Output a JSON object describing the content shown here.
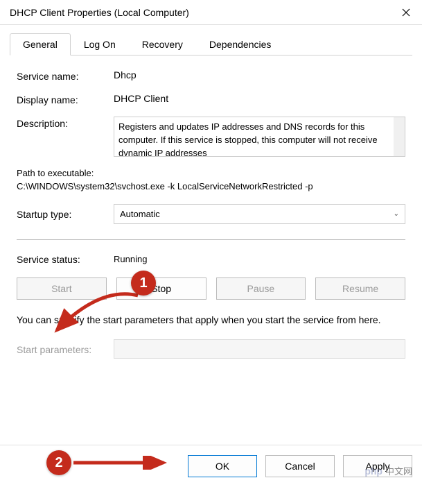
{
  "titlebar": {
    "title": "DHCP Client Properties (Local Computer)"
  },
  "tabs": {
    "general": "General",
    "logon": "Log On",
    "recovery": "Recovery",
    "dependencies": "Dependencies"
  },
  "general": {
    "service_name_label": "Service name:",
    "service_name_value": "Dhcp",
    "display_name_label": "Display name:",
    "display_name_value": "DHCP Client",
    "description_label": "Description:",
    "description_value": "Registers and updates IP addresses and DNS records for this computer. If this service is stopped, this computer will not receive dynamic IP addresses",
    "path_label": "Path to executable:",
    "path_value": "C:\\WINDOWS\\system32\\svchost.exe -k LocalServiceNetworkRestricted -p",
    "startup_type_label": "Startup type:",
    "startup_type_value": "Automatic",
    "status_label": "Service status:",
    "status_value": "Running",
    "buttons": {
      "start": "Start",
      "stop": "Stop",
      "pause": "Pause",
      "resume": "Resume"
    },
    "help_text": "You can specify the start parameters that apply when you start the service from here.",
    "start_params_label": "Start parameters:",
    "start_params_value": ""
  },
  "footer": {
    "ok": "OK",
    "cancel": "Cancel",
    "apply": "Apply"
  },
  "annotations": {
    "badge1": "1",
    "badge2": "2"
  },
  "watermark": {
    "brand": "php",
    "text": "中文网"
  }
}
